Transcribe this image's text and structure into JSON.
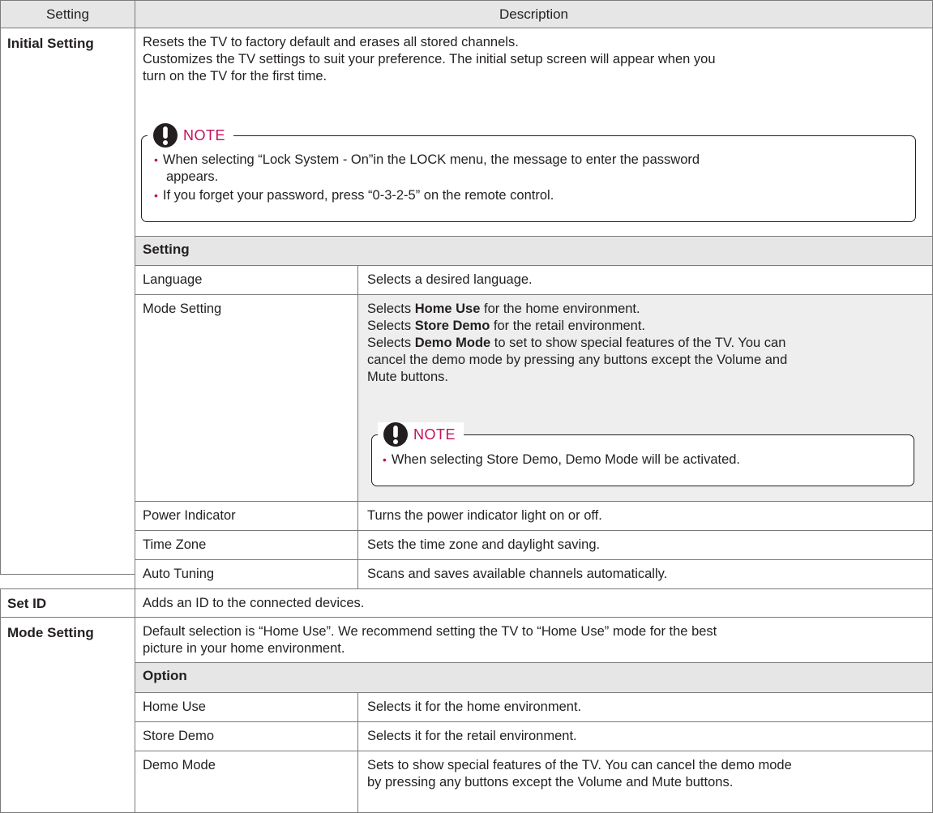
{
  "header": {
    "setting": "Setting",
    "description": "Description"
  },
  "initial_setting": {
    "label": "Initial Setting",
    "lines": [
      "Resets the TV to factory default and erases all stored channels.",
      "Customizes the TV settings to suit your preference. The initial setup screen will appear when you",
      "turn on the TV for the first time."
    ],
    "note": {
      "title": "NOTE",
      "items": [
        [
          "When selecting “Lock System - On”in the LOCK menu, the message to enter the password",
          "appears."
        ],
        [
          "If you forget your password, press “0-3-2-5” on the remote control."
        ]
      ]
    },
    "sub_header": "Setting",
    "rows": [
      {
        "name": "Language",
        "desc": "Selects a desired language."
      },
      {
        "name": "Mode Setting",
        "desc_lines": [
          {
            "pre": "Selects ",
            "kw": "Home Use",
            "post": " for the home environment."
          },
          {
            "pre": "Selects ",
            "kw": "Store Demo",
            "post": " for the retail environment."
          },
          {
            "pre": "Selects ",
            "kw": "Demo Mode",
            "post": " to set to show special features of the TV. You can"
          },
          {
            "pre": "cancel the demo mode by pressing any buttons except the Volume and",
            "kw": "",
            "post": ""
          },
          {
            "pre": "Mute buttons.",
            "kw": "",
            "post": ""
          }
        ],
        "note": {
          "title": "NOTE",
          "item": "When selecting Store Demo, Demo Mode will be activated."
        }
      },
      {
        "name": "Power Indicator",
        "desc": "Turns the power indicator light on or off."
      },
      {
        "name": "Time Zone",
        "desc": "Sets the time zone and daylight saving."
      },
      {
        "name": "Auto Tuning",
        "desc": "Scans and saves available channels automatically."
      }
    ]
  },
  "set_id": {
    "label": "Set ID",
    "desc": "Adds an ID to the connected devices."
  },
  "mode_setting": {
    "label": "Mode Setting",
    "lines": [
      "Default selection is “Home Use”. We recommend setting the TV to “Home Use” mode for the best",
      "picture in your home environment."
    ],
    "sub_header": "Option",
    "rows": [
      {
        "name": "Home Use",
        "desc": "Selects it for the home environment."
      },
      {
        "name": "Store Demo",
        "desc": "Selects it for the retail environment."
      },
      {
        "name": "Demo Mode",
        "desc_lines": [
          "Sets to show special features of the TV. You can cancel the demo mode",
          "by pressing any buttons except the Volume and Mute buttons."
        ]
      }
    ]
  }
}
